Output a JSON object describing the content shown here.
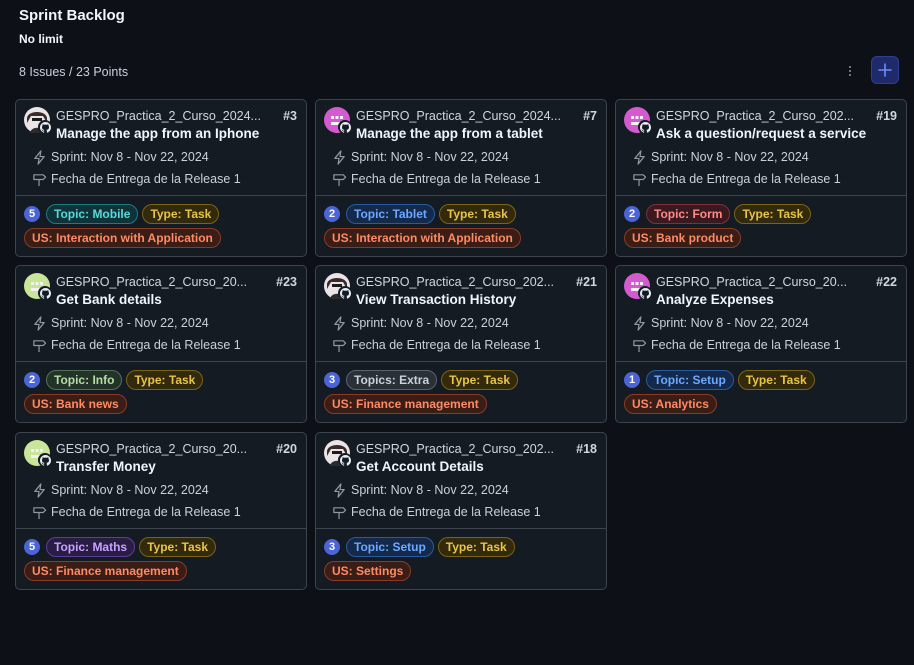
{
  "board": {
    "title": "Sprint Backlog",
    "limit": "No limit",
    "summary": "8 Issues / 23 Points",
    "menu_icon": "kebab-horizontal-icon",
    "add_icon": "plus-icon"
  },
  "colors": {
    "background": "#0d1117",
    "card": "#151b23",
    "border": "#3d444d",
    "points_badge": "#4b64d6",
    "accent": "#3b5bdb"
  },
  "label_styles": {
    "mobile": {
      "fg": "#5ad8dc",
      "bg": "#0e3338",
      "border": "#1d7a80"
    },
    "tablet": {
      "fg": "#6ea8fe",
      "bg": "#132a4d",
      "border": "#2b5a9c"
    },
    "form": {
      "fg": "#ff8a8a",
      "bg": "#3a1a1e",
      "border": "#7a3238"
    },
    "info": {
      "fg": "#b8dca8",
      "bg": "#233327",
      "border": "#51705a"
    },
    "extra": {
      "fg": "#c9d1d9",
      "bg": "#2b3038",
      "border": "#5a6270"
    },
    "setup": {
      "fg": "#6ea8fe",
      "bg": "#132a4d",
      "border": "#2b5a9c"
    },
    "maths": {
      "fg": "#c6a2ff",
      "bg": "#2a1d45",
      "border": "#5b3f93"
    },
    "task": {
      "fg": "#e8c547",
      "bg": "#33290b",
      "border": "#7a6316"
    },
    "us": {
      "fg": "#ff8a65",
      "bg": "#3a1d14",
      "border": "#8a3b26"
    }
  },
  "cards": [
    {
      "repo": "GESPRO_Practica_2_Curso_2024...",
      "number": "#3",
      "title": "Manage the app from an Iphone",
      "sprint": "Sprint: Nov 8 - Nov 22, 2024",
      "release": "Fecha de Entrega de la Release 1",
      "avatar": "avatar-anime-icon",
      "points": "5",
      "labels": [
        [
          {
            "text": "Topic: Mobile",
            "style": "mobile"
          },
          {
            "text": "Type: Task",
            "style": "task"
          }
        ],
        [
          {
            "text": "US: Interaction with Application",
            "style": "us"
          }
        ]
      ]
    },
    {
      "repo": "GESPRO_Practica_2_Curso_2024...",
      "number": "#7",
      "title": "Manage the app from a tablet",
      "sprint": "Sprint: Nov 8 - Nov 22, 2024",
      "release": "Fecha de Entrega de la Release 1",
      "avatar": "avatar-identicon-pink",
      "points": "2",
      "labels": [
        [
          {
            "text": "Topic: Tablet",
            "style": "tablet"
          },
          {
            "text": "Type: Task",
            "style": "task"
          }
        ],
        [
          {
            "text": "US: Interaction with Application",
            "style": "us"
          }
        ]
      ]
    },
    {
      "repo": "GESPRO_Practica_2_Curso_202...",
      "number": "#19",
      "title": "Ask a question/request a service",
      "sprint": "Sprint: Nov 8 - Nov 22, 2024",
      "release": "Fecha de Entrega de la Release 1",
      "avatar": "avatar-identicon-pink",
      "points": "2",
      "labels": [
        [
          {
            "text": "Topic: Form",
            "style": "form"
          },
          {
            "text": "Type: Task",
            "style": "task"
          }
        ],
        [
          {
            "text": "US: Bank product",
            "style": "us"
          }
        ]
      ]
    },
    {
      "repo": "GESPRO_Practica_2_Curso_20...",
      "number": "#23",
      "title": "Get Bank details",
      "sprint": "Sprint: Nov 8 - Nov 22, 2024",
      "release": "Fecha de Entrega de la Release 1",
      "avatar": "avatar-identicon-green",
      "points": "2",
      "labels": [
        [
          {
            "text": "Topic: Info",
            "style": "info"
          },
          {
            "text": "Type: Task",
            "style": "task"
          }
        ],
        [
          {
            "text": "US: Bank news",
            "style": "us"
          }
        ]
      ]
    },
    {
      "repo": "GESPRO_Practica_2_Curso_202...",
      "number": "#21",
      "title": "View Transaction History",
      "sprint": "Sprint: Nov 8 - Nov 22, 2024",
      "release": "Fecha de Entrega de la Release 1",
      "avatar": "avatar-anime-icon",
      "points": "3",
      "labels": [
        [
          {
            "text": "Topics: Extra",
            "style": "extra"
          },
          {
            "text": "Type: Task",
            "style": "task"
          }
        ],
        [
          {
            "text": "US: Finance management",
            "style": "us"
          }
        ]
      ]
    },
    {
      "repo": "GESPRO_Practica_2_Curso_20...",
      "number": "#22",
      "title": "Analyze Expenses",
      "sprint": "Sprint: Nov 8 - Nov 22, 2024",
      "release": "Fecha de Entrega de la Release 1",
      "avatar": "avatar-identicon-pink",
      "points": "1",
      "labels": [
        [
          {
            "text": "Topic: Setup",
            "style": "setup"
          },
          {
            "text": "Type: Task",
            "style": "task"
          }
        ],
        [
          {
            "text": "US: Analytics",
            "style": "us"
          }
        ]
      ]
    },
    {
      "repo": "GESPRO_Practica_2_Curso_20...",
      "number": "#20",
      "title": "Transfer Money",
      "sprint": "Sprint: Nov 8 - Nov 22, 2024",
      "release": "Fecha de Entrega de la Release 1",
      "avatar": "avatar-identicon-green",
      "points": "5",
      "labels": [
        [
          {
            "text": "Topic: Maths",
            "style": "maths"
          },
          {
            "text": "Type: Task",
            "style": "task"
          }
        ],
        [
          {
            "text": "US: Finance management",
            "style": "us"
          }
        ]
      ]
    },
    {
      "repo": "GESPRO_Practica_2_Curso_202...",
      "number": "#18",
      "title": "Get Account Details",
      "sprint": "Sprint: Nov 8 - Nov 22, 2024",
      "release": "Fecha de Entrega de la Release 1",
      "avatar": "avatar-anime-icon",
      "points": "3",
      "labels": [
        [
          {
            "text": "Topic: Setup",
            "style": "setup"
          },
          {
            "text": "Type: Task",
            "style": "task"
          }
        ],
        [
          {
            "text": "US: Settings",
            "style": "us"
          }
        ]
      ]
    }
  ]
}
